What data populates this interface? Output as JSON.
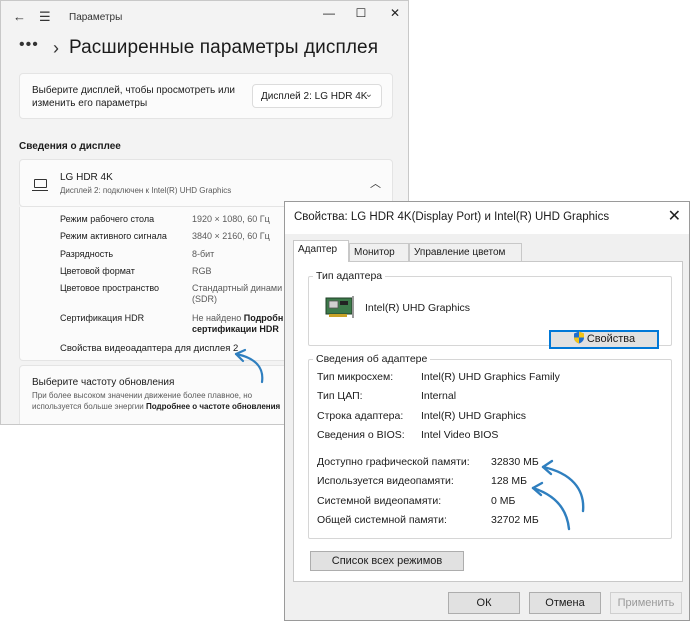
{
  "settings": {
    "window_title": "Параметры",
    "page_title": "Расширенные параметры дисплея",
    "select_display_text": "Выберите дисплей, чтобы просмотреть или изменить его параметры",
    "display_dropdown": "Дисплей 2: LG HDR 4K",
    "section_label": "Сведения о дисплее",
    "monitor_name": "LG HDR 4K",
    "monitor_sub": "Дисплей 2: подключен к Intel(R) UHD Graphics",
    "info_rows": [
      {
        "label": "Режим рабочего стола",
        "value": "1920 × 1080, 60 Гц"
      },
      {
        "label": "Режим активного сигнала",
        "value": "3840 × 2160, 60 Гц"
      },
      {
        "label": "Разрядность",
        "value": "8-бит"
      },
      {
        "label": "Цветовой формат",
        "value": "RGB"
      },
      {
        "label": "Цветовое пространство",
        "value": "Стандартный динами",
        "value2": "(SDR)"
      },
      {
        "label": "Сертификация HDR",
        "value": "Не найдено ",
        "value_bold": "Подробн",
        "value2_bold": "сертификации HDR"
      }
    ],
    "adapter_link": "Свойства видеоадаптера для дисплея 2",
    "refresh_title": "Выберите частоту обновления",
    "refresh_desc": "При более высоком значении движение более плавное, но используется больше энергии",
    "refresh_more": "Подробнее о частоте обновления"
  },
  "dialog": {
    "title": "Свойства: LG HDR 4K(Display Port) и Intel(R) UHD Graphics",
    "tabs": [
      "Адаптер",
      "Монитор",
      "Управление цветом"
    ],
    "adapter_type_legend": "Тип адаптера",
    "adapter_name": "Intel(R) UHD Graphics",
    "properties_button": "Свойства",
    "adapter_info_legend": "Сведения об адаптере",
    "adapter_info": [
      {
        "label": "Тип микросхем:",
        "value": "Intel(R) UHD Graphics Family"
      },
      {
        "label": "Тип ЦАП:",
        "value": "Internal"
      },
      {
        "label": "Строка адаптера:",
        "value": "Intel(R) UHD Graphics"
      },
      {
        "label": "Сведения о BIOS:",
        "value": "Intel Video BIOS"
      }
    ],
    "memory_info": [
      {
        "label": "Доступно графической памяти:",
        "value": "32830 МБ"
      },
      {
        "label": "Используется видеопамяти:",
        "value": "128 МБ"
      },
      {
        "label": "Системной видеопамяти:",
        "value": "0 МБ"
      },
      {
        "label": "Общей системной памяти:",
        "value": "32702 МБ"
      }
    ],
    "list_modes_button": "Список всех режимов",
    "ok_button": "ОК",
    "cancel_button": "Отмена",
    "apply_button": "Применить"
  },
  "colors": {
    "accent": "#0078d7",
    "annotation_arrow": "#2f7fbf"
  }
}
